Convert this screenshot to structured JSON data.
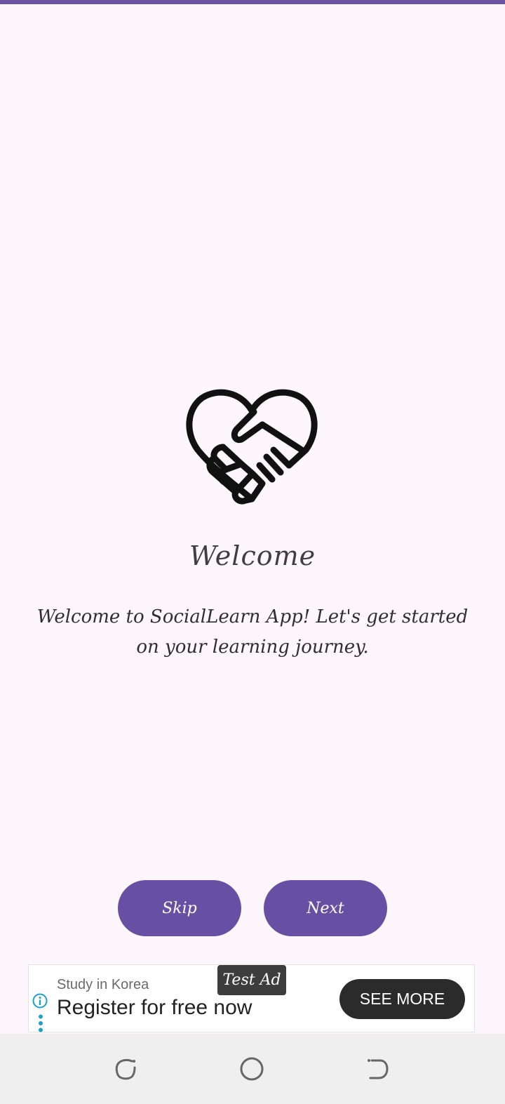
{
  "colors": {
    "accent": "#6750a4",
    "top_bar": "#6b52a3",
    "background": "#fdf7fd",
    "ad_button": "#2b2b2b",
    "ad_info": "#1aa3c8",
    "nav_bar": "#efefef"
  },
  "onboarding": {
    "logo_icon": "heart-handshake-icon",
    "title": "Welcome",
    "description": "Welcome to SocialLearn App! Let's get started on your learning journey.",
    "skip_label": "Skip",
    "next_label": "Next"
  },
  "ad": {
    "tag": "Test Ad",
    "headline": "Study in Korea",
    "body": "Register for free now",
    "cta_label": "SEE MORE",
    "info_icon": "info-icon",
    "menu_icon": "more-vertical-icon"
  },
  "nav": {
    "recents_icon": "recents-icon",
    "home_icon": "home-icon",
    "back_icon": "back-icon"
  }
}
